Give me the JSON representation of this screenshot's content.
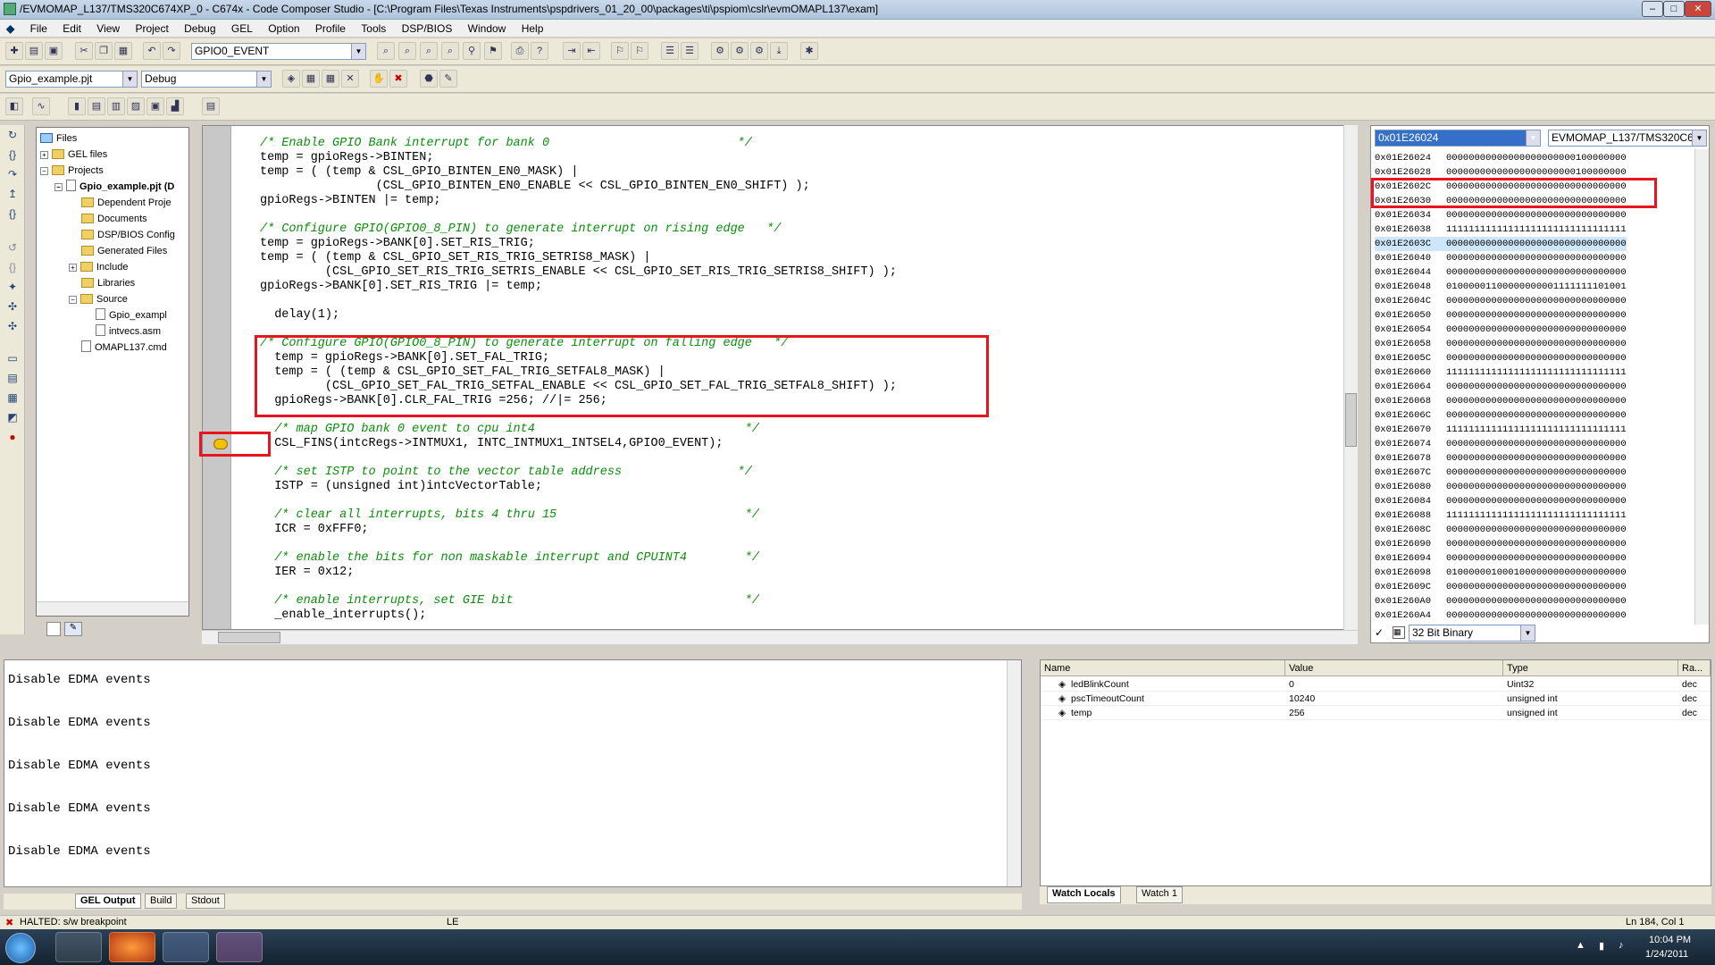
{
  "window": {
    "title": "/EVMOMAP_L137/TMS320C674XP_0 - C674x - Code Composer Studio - [C:\\Program Files\\Texas Instruments\\pspdrivers_01_20_00\\packages\\ti\\pspiom\\cslr\\evmOMAPL137\\exam]"
  },
  "menu": [
    "File",
    "Edit",
    "View",
    "Project",
    "Debug",
    "GEL",
    "Option",
    "Profile",
    "Tools",
    "DSP/BIOS",
    "Window",
    "Help"
  ],
  "toolbar": {
    "symbol_combo": "GPIO0_EVENT",
    "project_combo": "Gpio_example.pjt",
    "config_combo": "Debug"
  },
  "tree": {
    "nodes": [
      {
        "label": "Files"
      },
      {
        "label": "GEL files"
      },
      {
        "label": "Projects"
      },
      {
        "label": "Gpio_example.pjt (D"
      },
      {
        "label": "Dependent Proje"
      },
      {
        "label": "Documents"
      },
      {
        "label": "DSP/BIOS Config"
      },
      {
        "label": "Generated Files"
      },
      {
        "label": "Include"
      },
      {
        "label": "Libraries"
      },
      {
        "label": "Source"
      },
      {
        "label": "Gpio_exampl"
      },
      {
        "label": "intvecs.asm"
      },
      {
        "label": "OMAPL137.cmd"
      }
    ]
  },
  "code": {
    "l1": "/* Enable GPIO Bank interrupt for bank 0                          */",
    "l2": "temp = gpioRegs->BINTEN;",
    "l3": "temp = ( (temp & CSL_GPIO_BINTEN_EN0_MASK) |",
    "l4": "                (CSL_GPIO_BINTEN_EN0_ENABLE << CSL_GPIO_BINTEN_EN0_SHIFT) );",
    "l5": "gpioRegs->BINTEN |= temp;",
    "l6": "/* Configure GPIO(GPIO0_8_PIN) to generate interrupt on rising edge   */",
    "l7": "temp = gpioRegs->BANK[0].SET_RIS_TRIG;",
    "l8": "temp = ( (temp & CSL_GPIO_SET_RIS_TRIG_SETRIS8_MASK) |",
    "l9": "         (CSL_GPIO_SET_RIS_TRIG_SETRIS_ENABLE << CSL_GPIO_SET_RIS_TRIG_SETRIS8_SHIFT) );",
    "l10": "gpioRegs->BANK[0].SET_RIS_TRIG |= temp;",
    "l11": "  delay(1);",
    "l12": "/* Configure GPIO(GPIO0_8_PIN) to generate interrupt on falling edge   */",
    "l13": "  temp = gpioRegs->BANK[0].SET_FAL_TRIG;",
    "l14": "  temp = ( (temp & CSL_GPIO_SET_FAL_TRIG_SETFAL8_MASK) |",
    "l15": "         (CSL_GPIO_SET_FAL_TRIG_SETFAL_ENABLE << CSL_GPIO_SET_FAL_TRIG_SETFAL8_SHIFT) );",
    "l16": "  gpioRegs->BANK[0].CLR_FAL_TRIG =256; //|= 256;",
    "l17": "  /* map GPIO bank 0 event to cpu int4                             */",
    "l18": "  CSL_FINS(intcRegs->INTMUX1, INTC_INTMUX1_INTSEL4,GPIO0_EVENT);",
    "l19": "  /* set ISTP to point to the vector table address                */",
    "l20": "  ISTP = (unsigned int)intcVectorTable;",
    "l21": "  /* clear all interrupts, bits 4 thru 15                          */",
    "l22": "  ICR = 0xFFF0;",
    "l23": "  /* enable the bits for non maskable interrupt and CPUINT4        */",
    "l24": "  IER = 0x12;",
    "l25": "  /* enable interrupts, set GIE bit                                */",
    "l26": "  _enable_interrupts();"
  },
  "memory": {
    "address_combo": "0x01E26024",
    "target_combo": "EVMOMAP_L137/TMS320C674>",
    "format_combo": "32 Bit Binary",
    "rows": [
      [
        "0x01E26024",
        "00000000000000000000000100000000"
      ],
      [
        "0x01E26028",
        "00000000000000000000000100000000"
      ],
      [
        "0x01E2602C",
        "00000000000000000000000000000000"
      ],
      [
        "0x01E26030",
        "00000000000000000000000000000000"
      ],
      [
        "0x01E26034",
        "00000000000000000000000000000000"
      ],
      [
        "0x01E26038",
        "11111111111111111111111111111111"
      ],
      [
        "0x01E2603C",
        "00000000000000000000000000000000"
      ],
      [
        "0x01E26040",
        "00000000000000000000000000000000"
      ],
      [
        "0x01E26044",
        "00000000000000000000000000000000"
      ],
      [
        "0x01E26048",
        "01000001100000000001111111101001"
      ],
      [
        "0x01E2604C",
        "00000000000000000000000000000000"
      ],
      [
        "0x01E26050",
        "00000000000000000000000000000000"
      ],
      [
        "0x01E26054",
        "00000000000000000000000000000000"
      ],
      [
        "0x01E26058",
        "00000000000000000000000000000000"
      ],
      [
        "0x01E2605C",
        "00000000000000000000000000000000"
      ],
      [
        "0x01E26060",
        "11111111111111111111111111111111"
      ],
      [
        "0x01E26064",
        "00000000000000000000000000000000"
      ],
      [
        "0x01E26068",
        "00000000000000000000000000000000"
      ],
      [
        "0x01E2606C",
        "00000000000000000000000000000000"
      ],
      [
        "0x01E26070",
        "11111111111111111111111111111111"
      ],
      [
        "0x01E26074",
        "00000000000000000000000000000000"
      ],
      [
        "0x01E26078",
        "00000000000000000000000000000000"
      ],
      [
        "0x01E2607C",
        "00000000000000000000000000000000"
      ],
      [
        "0x01E26080",
        "00000000000000000000000000000000"
      ],
      [
        "0x01E26084",
        "00000000000000000000000000000000"
      ],
      [
        "0x01E26088",
        "11111111111111111111111111111111"
      ],
      [
        "0x01E2608C",
        "00000000000000000000000000000000"
      ],
      [
        "0x01E26090",
        "00000000000000000000000000000000"
      ],
      [
        "0x01E26094",
        "00000000000000000000000000000000"
      ],
      [
        "0x01E26098",
        "01000000100010000000000000000000"
      ],
      [
        "0x01E2609C",
        "00000000000000000000000000000000"
      ],
      [
        "0x01E260A0",
        "00000000000000000000000000000000"
      ],
      [
        "0x01E260A4",
        "00000000000000000000000000000000"
      ]
    ]
  },
  "output": {
    "lines": [
      "Disable EDMA events",
      "Disable EDMA events",
      "Disable EDMA events",
      "Disable EDMA events",
      "Disable EDMA events"
    ],
    "tabs": [
      "GEL Output",
      "Build",
      "Stdout"
    ]
  },
  "watch": {
    "headers": [
      "Name",
      "Value",
      "Type",
      "Ra..."
    ],
    "rows": [
      [
        "ledBlinkCount",
        "0",
        "Uint32",
        "dec"
      ],
      [
        "pscTimeoutCount",
        "10240",
        "unsigned int",
        "dec"
      ],
      [
        "temp",
        "256",
        "unsigned int",
        "dec"
      ]
    ],
    "tabs": [
      "Watch Locals",
      "Watch 1"
    ]
  },
  "status": {
    "state": "HALTED: s/w breakpoint",
    "mode": "LE",
    "position": "Ln 184, Col 1"
  },
  "taskbar": {
    "time": "10:04 PM",
    "date": "1/24/2011"
  }
}
